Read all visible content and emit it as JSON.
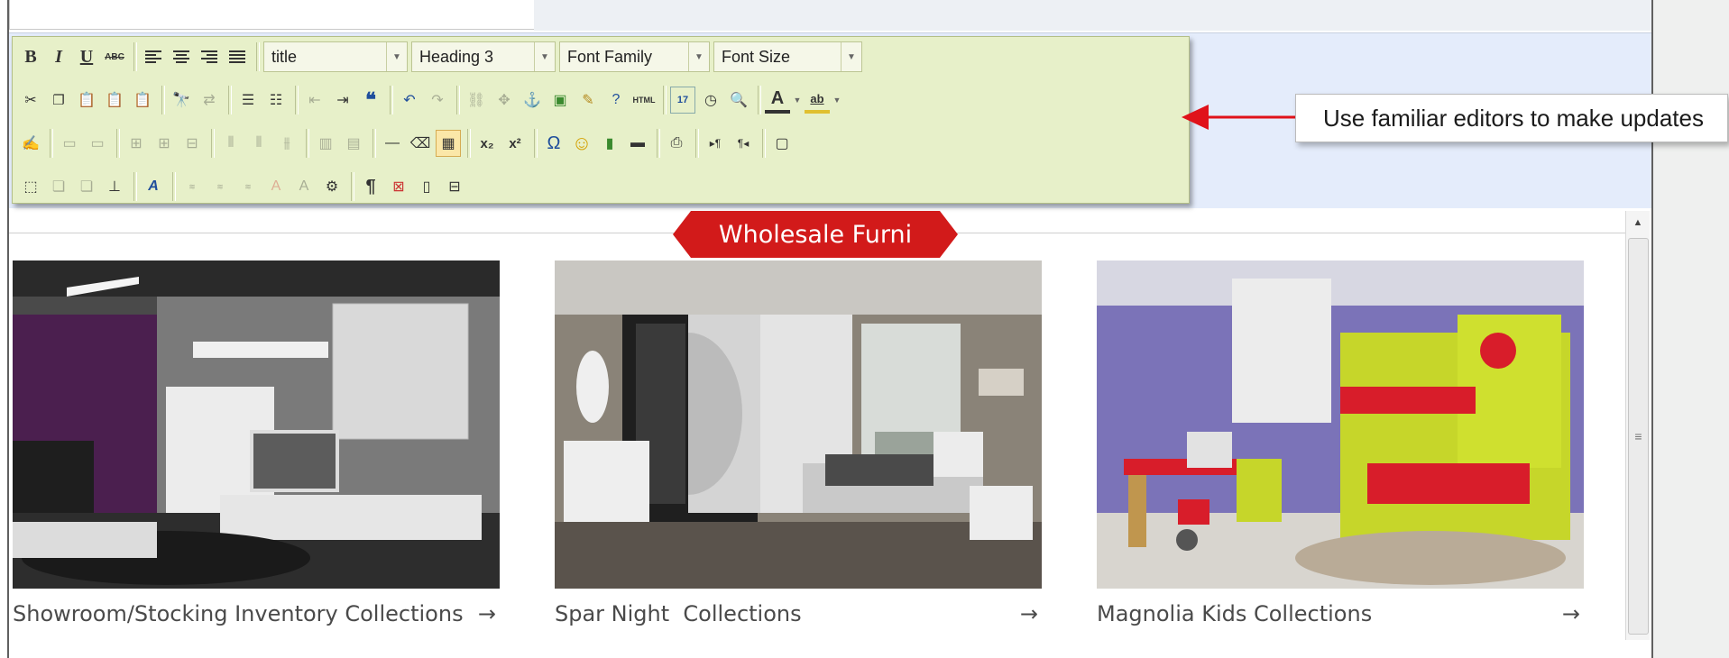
{
  "toolbar": {
    "format_select": "title",
    "heading_select": "Heading 3",
    "font_family_select": "Font Family",
    "font_size_select": "Font Size",
    "bold_label": "B",
    "italic_label": "I",
    "underline_label": "U",
    "strike_label": "ABC",
    "subscript_label": "x₂",
    "superscript_label": "x²",
    "omega_label": "Ω",
    "html_label": "HTML",
    "calendar_label": "17",
    "text_color_label": "A",
    "highlight_label": "ab",
    "pilcrow_label": "¶"
  },
  "callout": {
    "text": "Use familiar editors to make updates"
  },
  "banner": {
    "title": "Wholesale Furni"
  },
  "products": [
    {
      "caption": "Showroom/Stocking Inventory Collections",
      "arrow": "→"
    },
    {
      "caption": "Spar Night  Collections",
      "arrow": "→"
    },
    {
      "caption": "Magnolia Kids Collections",
      "arrow": "→"
    }
  ],
  "colors": {
    "toolbar_bg": "#e7f0c9",
    "banner_red": "#d21a1a",
    "callout_arrow": "#e0121a",
    "editor_bg": "#e4ecfb"
  }
}
